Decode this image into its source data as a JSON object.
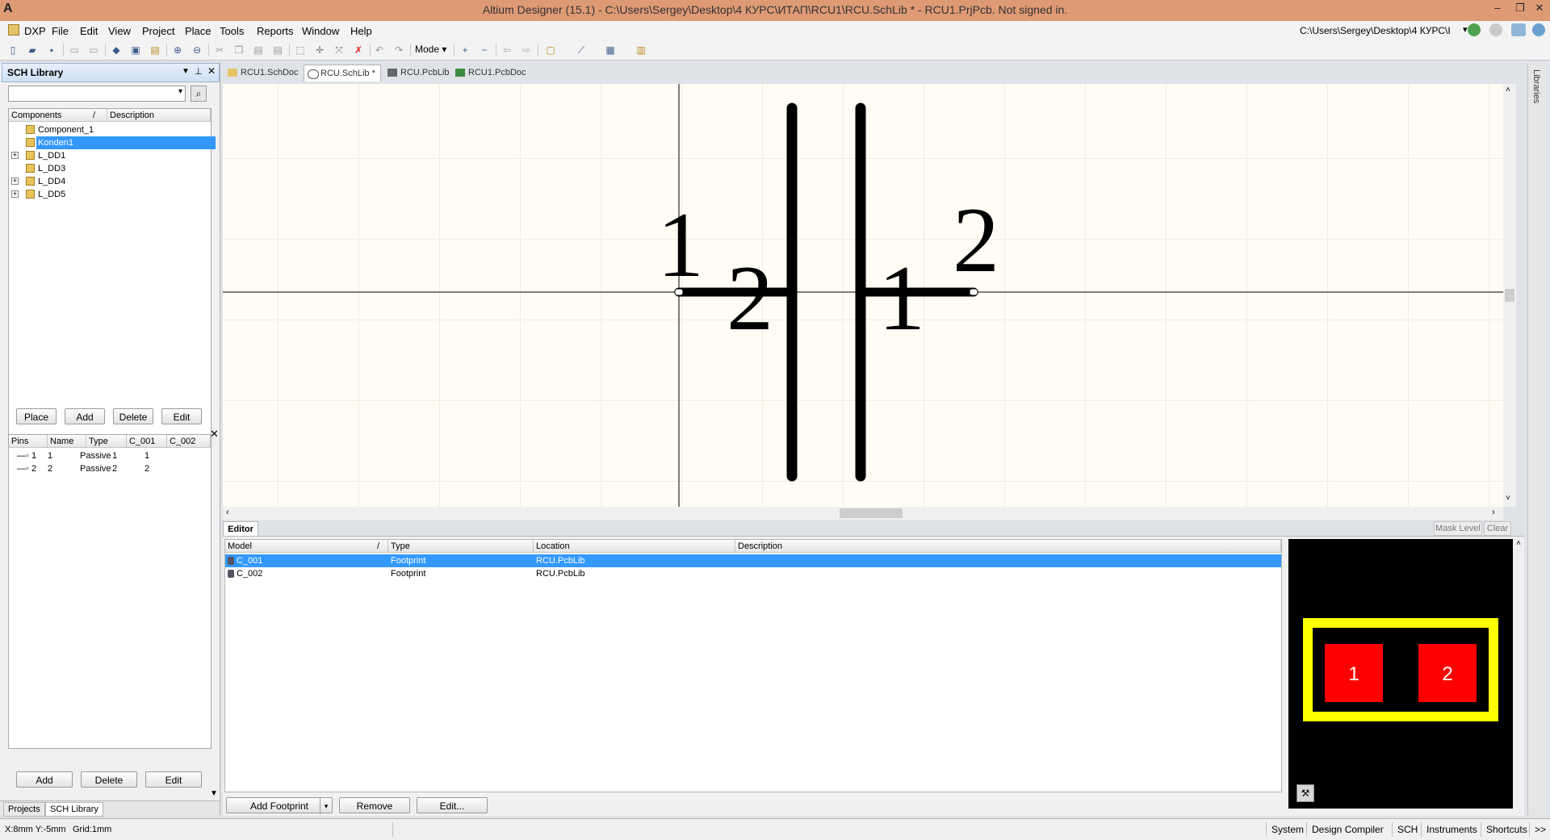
{
  "window": {
    "title": "Altium Designer (15.1) - C:\\Users\\Sergey\\Desktop\\4 КУРС\\ИТАП\\RCU1\\RCU.SchLib * - RCU1.PrjPcb. Not signed in.",
    "logo": "A",
    "minimize": "–",
    "restore": "❐",
    "close": "✕"
  },
  "menu": [
    "DXP",
    "File",
    "Edit",
    "View",
    "Project",
    "Place",
    "Tools",
    "Reports",
    "Window",
    "Help"
  ],
  "toolbar": {
    "mode_label": "Mode",
    "path": "C:\\Users\\Sergey\\Desktop\\4 КУРС\\I"
  },
  "left_panel": {
    "title": "SCH Library",
    "components_header": "Components",
    "sort_marker": "/",
    "description_header": "Description",
    "components": [
      {
        "label": "Component_1",
        "expandable": false,
        "selected": false
      },
      {
        "label": "Konden1",
        "expandable": false,
        "selected": true
      },
      {
        "label": "L_DD1",
        "expandable": true,
        "selected": false
      },
      {
        "label": "L_DD3",
        "expandable": false,
        "selected": false
      },
      {
        "label": "L_DD4",
        "expandable": true,
        "selected": false
      },
      {
        "label": "L_DD5",
        "expandable": true,
        "selected": false
      }
    ],
    "component_buttons": [
      "Place",
      "Add",
      "Delete",
      "Edit"
    ],
    "pins_headers": [
      "Pins",
      "Name",
      "Type",
      "C_001",
      "C_002"
    ],
    "pins": [
      {
        "pin": "1",
        "name": "1",
        "type": "Passive",
        "c001": "1",
        "c002": "1"
      },
      {
        "pin": "2",
        "name": "2",
        "type": "Passive",
        "c001": "2",
        "c002": "2"
      }
    ],
    "pin_buttons": [
      "Add",
      "Delete",
      "Edit"
    ],
    "bottom_tabs": [
      "Projects",
      "SCH Library"
    ]
  },
  "doc_tabs": [
    {
      "label": "RCU1.SchDoc",
      "active": false
    },
    {
      "label": "RCU.SchLib *",
      "active": true
    },
    {
      "label": "RCU.PcbLib",
      "active": false
    },
    {
      "label": "RCU1.PcbDoc",
      "active": false
    }
  ],
  "schematic": {
    "pin1_number": "1",
    "pin1_name": "2",
    "pin2_number": "2",
    "pin2_name": "1"
  },
  "editor": {
    "tab": "Editor",
    "mask_level": "Mask Level",
    "clear": "Clear",
    "headers": [
      "Model",
      "Type",
      "Location",
      "Description"
    ],
    "sort_marker": "/",
    "models": [
      {
        "model": "C_001",
        "type": "Footprint",
        "location": "RCU.PcbLib",
        "description": "",
        "selected": true
      },
      {
        "model": "C_002",
        "type": "Footprint",
        "location": "RCU.PcbLib",
        "description": "",
        "selected": false
      }
    ],
    "buttons": [
      "Add Footprint",
      "Remove",
      "Edit..."
    ],
    "preview_pads": [
      "1",
      "2"
    ],
    "colors": {
      "pad": "#ff0000",
      "outline": "#ffff00",
      "background": "#000000",
      "selection": "#3399ff"
    }
  },
  "status": {
    "coords": "X:8mm Y:-5mm",
    "grid": "Grid:1mm",
    "buttons": [
      "System",
      "Design Compiler",
      "SCH",
      "Instruments",
      "Shortcuts",
      ">>"
    ]
  },
  "right_strip": "Libraries"
}
